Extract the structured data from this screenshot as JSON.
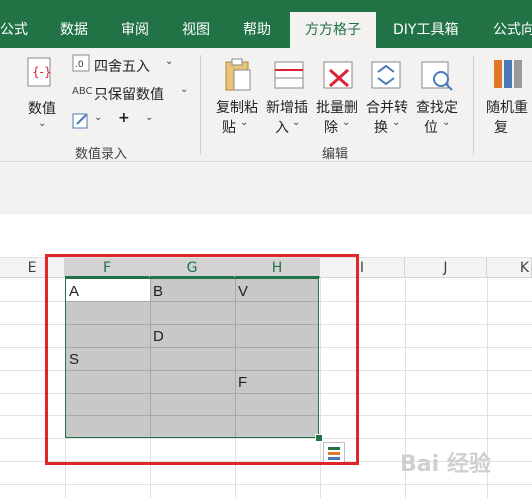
{
  "tabs": [
    {
      "label": "公式"
    },
    {
      "label": "数据"
    },
    {
      "label": "审阅"
    },
    {
      "label": "视图"
    },
    {
      "label": "帮助"
    },
    {
      "label": "方方格子"
    },
    {
      "label": "DIY工具箱"
    },
    {
      "label": "公式向"
    }
  ],
  "ribbon": {
    "shuzhi_label": "数值",
    "round_label": "四舍五入",
    "keep_value_label": "只保留数值",
    "abc_label": "ABC",
    "plus_label": "+",
    "group1_label": "数值录入",
    "copy_paste_label1": "复制粘",
    "copy_paste_label2": "贴",
    "insert_label1": "新增插",
    "insert_label2": "入",
    "delete_label1": "批量删",
    "delete_label2": "除",
    "merge_label1": "合并转",
    "merge_label2": "换",
    "find_label1": "查找定",
    "find_label2": "位",
    "group2_label": "编辑",
    "random_label1": "随机重",
    "random_label2": "复"
  },
  "columns": [
    "E",
    "F",
    "G",
    "H",
    "I",
    "J",
    "K"
  ],
  "cells": {
    "F1": "A",
    "G1": "B",
    "H1": "V",
    "G3": "D",
    "F4": "S",
    "H5": "F"
  },
  "watermark": "Bai 经验"
}
